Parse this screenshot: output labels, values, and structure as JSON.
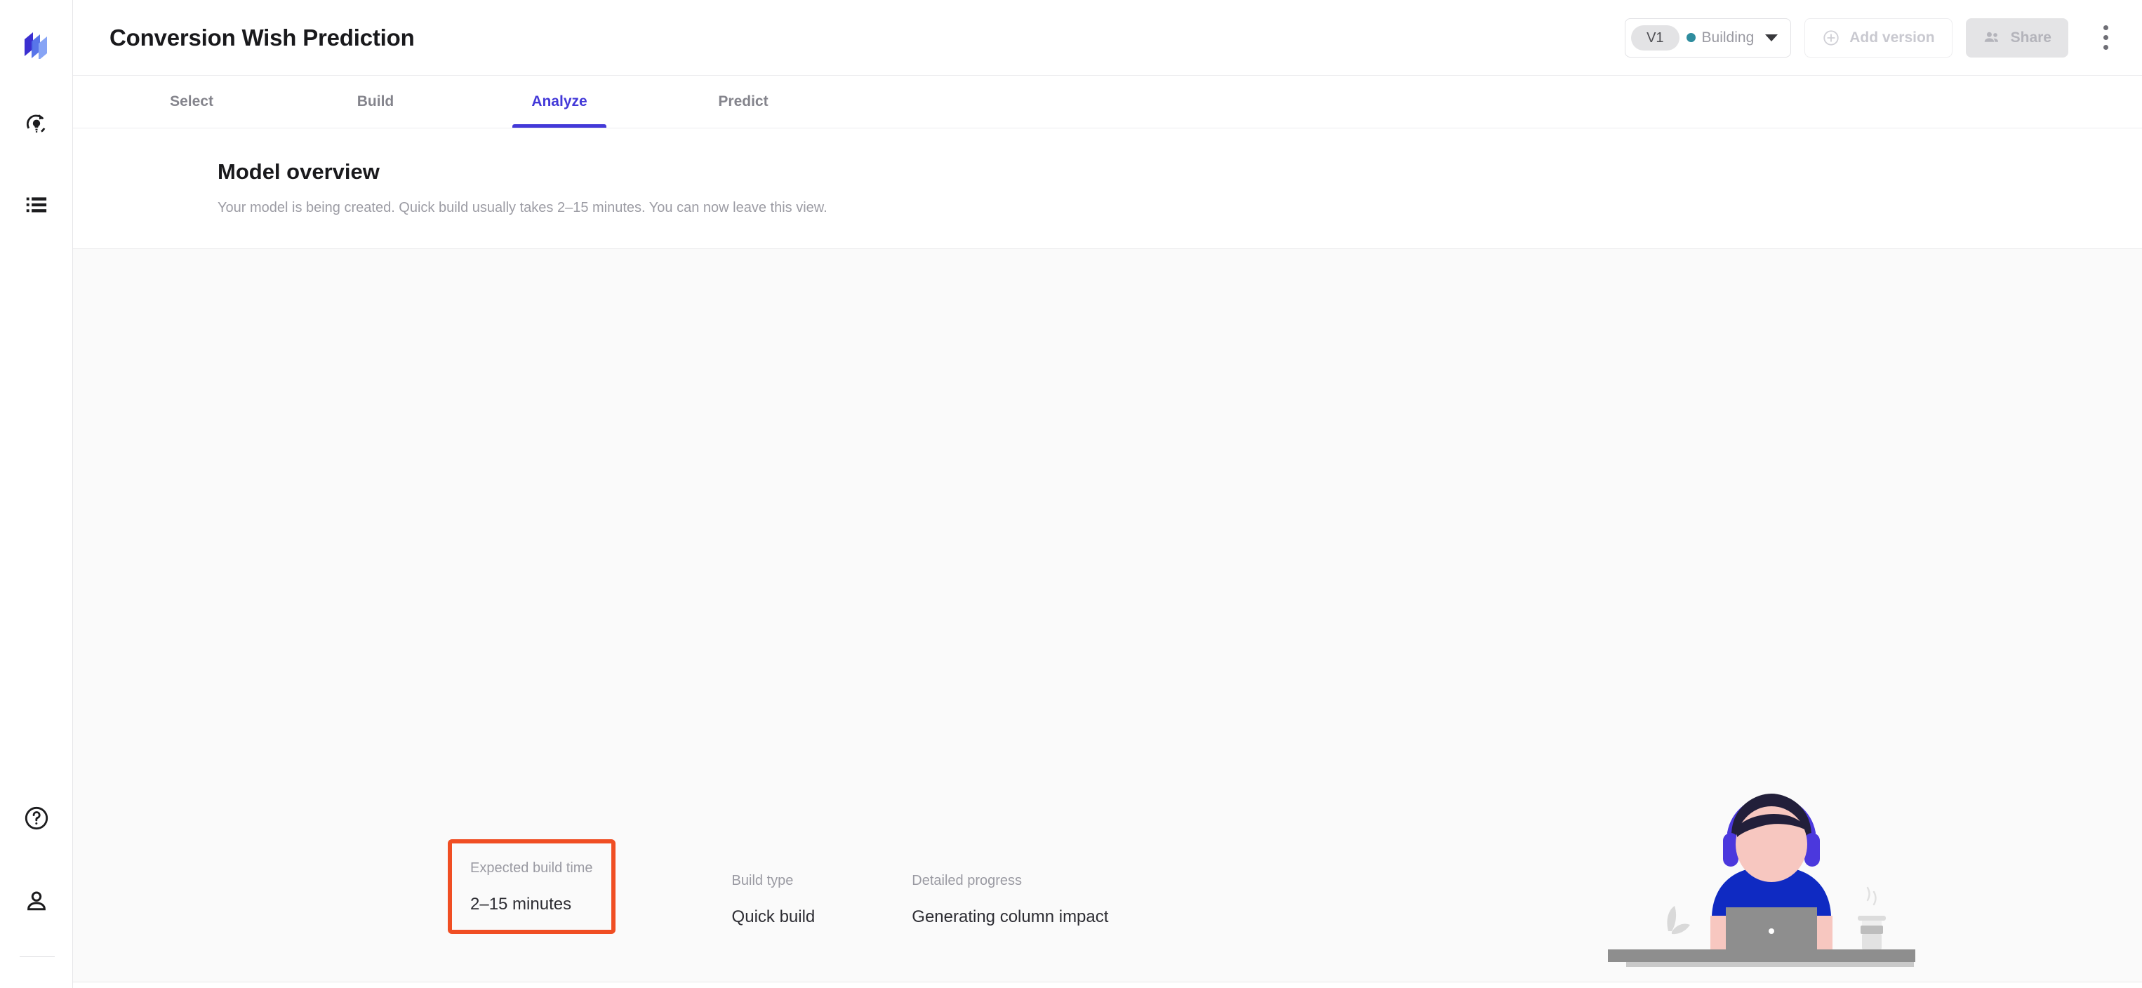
{
  "app": {
    "logo_icon": "layered-panels-logo",
    "brand_colors": {
      "primary": "#4339d8",
      "accent": "#2e8c9e",
      "highlight": "#f04e23"
    }
  },
  "sidebar": {
    "top_items": [
      {
        "icon": "rotate-lightbulb-icon",
        "name": "predictions"
      },
      {
        "icon": "list-bullets-icon",
        "name": "datasets"
      }
    ],
    "bottom_items": [
      {
        "icon": "help-circle-icon",
        "name": "help"
      },
      {
        "icon": "user-person-icon",
        "name": "account"
      }
    ]
  },
  "header": {
    "title": "Conversion Wish Prediction",
    "version": {
      "chip_label": "V1",
      "status_label": "Building",
      "status_dot_color": "#2e8c9e",
      "caret_icon": "chevron-down-icon"
    },
    "add_version": {
      "label": "Add version",
      "icon": "plus-circle-icon"
    },
    "share": {
      "label": "Share",
      "icon": "people-group-icon"
    },
    "overflow": {
      "icon": "kebab-menu-icon"
    }
  },
  "tabs": [
    {
      "label": "Select",
      "active": false
    },
    {
      "label": "Build",
      "active": false
    },
    {
      "label": "Analyze",
      "active": true
    },
    {
      "label": "Predict",
      "active": false
    }
  ],
  "overview": {
    "title": "Model overview",
    "subtitle": "Your model is being created. Quick build usually takes 2–15 minutes. You can now leave this view."
  },
  "status_row": {
    "cells": [
      {
        "label": "Expected build time",
        "value": "2–15 minutes",
        "highlighted": true
      },
      {
        "label": "Build type",
        "value": "Quick build",
        "highlighted": false
      },
      {
        "label": "Detailed progress",
        "value": "Generating column impact",
        "highlighted": false
      }
    ]
  },
  "illustration": {
    "name": "person-at-laptop-illustration",
    "colors": {
      "hair": "#221f3a",
      "headphones": "#4b38dd",
      "skin": "#f7c7c0",
      "shirt": "#0f2ac2",
      "laptop": "#8e8e8e",
      "desk": "#8e8e8e",
      "plant": "#d9d9d9",
      "cup": "#d4d4d4"
    }
  }
}
